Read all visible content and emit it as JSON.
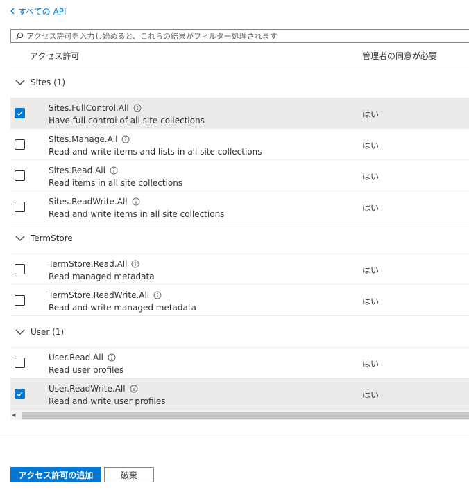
{
  "nav": {
    "back_label": "すべての API"
  },
  "filter": {
    "placeholder": "アクセス許可を入力し始めると、これらの結果がフィルター処理されます"
  },
  "table": {
    "col_permission": "アクセス許可",
    "col_admin_consent": "管理者の同意が必要"
  },
  "groups": [
    {
      "label": "Sites (1)",
      "rows": [
        {
          "name": "Sites.FullControl.All",
          "desc": "Have full control of all site collections",
          "consent": "はい",
          "checked": true
        },
        {
          "name": "Sites.Manage.All",
          "desc": "Read and write items and lists in all site collections",
          "consent": "はい",
          "checked": false
        },
        {
          "name": "Sites.Read.All",
          "desc": "Read items in all site collections",
          "consent": "はい",
          "checked": false
        },
        {
          "name": "Sites.ReadWrite.All",
          "desc": "Read and write items in all site collections",
          "consent": "はい",
          "checked": false
        }
      ]
    },
    {
      "label": "TermStore",
      "rows": [
        {
          "name": "TermStore.Read.All",
          "desc": "Read managed metadata",
          "consent": "はい",
          "checked": false
        },
        {
          "name": "TermStore.ReadWrite.All",
          "desc": "Read and write managed metadata",
          "consent": "はい",
          "checked": false
        }
      ]
    },
    {
      "label": "User (1)",
      "rows": [
        {
          "name": "User.Read.All",
          "desc": "Read user profiles",
          "consent": "はい",
          "checked": false
        },
        {
          "name": "User.ReadWrite.All",
          "desc": "Read and write user profiles",
          "consent": "はい",
          "checked": true
        }
      ]
    }
  ],
  "buttons": {
    "add_label": "アクセス許可の追加",
    "discard_label": "破棄"
  },
  "icons": {
    "back": "chevron-left-icon",
    "search": "search-icon",
    "group_toggle": "chevron-down-icon",
    "info": "info-icon",
    "check": "checkmark-icon"
  },
  "colors": {
    "accent": "#0078d4",
    "selected_row": "#edebe9",
    "text": "#323130"
  }
}
